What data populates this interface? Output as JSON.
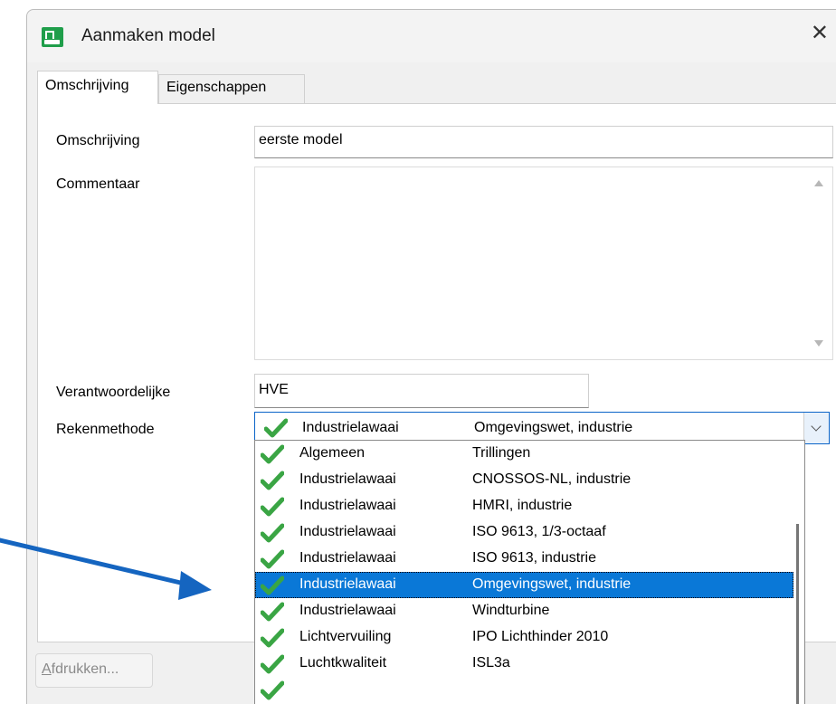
{
  "window": {
    "title": "Aanmaken model",
    "close_glyph": "✕"
  },
  "tabs": [
    {
      "label": "Omschrijving",
      "active": true
    },
    {
      "label": "Eigenschappen",
      "active": false
    }
  ],
  "form": {
    "omschrijving": {
      "label": "Omschrijving",
      "value": "eerste model"
    },
    "commentaar": {
      "label": "Commentaar",
      "value": ""
    },
    "verantwoordelijke": {
      "label": "Verantwoordelijke",
      "value": "HVE"
    },
    "rekenmethode": {
      "label": "Rekenmethode",
      "selected": {
        "category": "Industrielawaai",
        "method": "Omgevingswet, industrie"
      }
    }
  },
  "dropdown": {
    "options": [
      {
        "category": "Algemeen",
        "method": "Trillingen",
        "selected": false
      },
      {
        "category": "Industrielawaai",
        "method": "CNOSSOS-NL, industrie",
        "selected": false
      },
      {
        "category": "Industrielawaai",
        "method": "HMRI, industrie",
        "selected": false
      },
      {
        "category": "Industrielawaai",
        "method": "ISO 9613, 1/3-octaaf",
        "selected": false
      },
      {
        "category": "Industrielawaai",
        "method": "ISO 9613, industrie",
        "selected": false
      },
      {
        "category": "Industrielawaai",
        "method": "Omgevingswet, industrie",
        "selected": true
      },
      {
        "category": "Industrielawaai",
        "method": "Windturbine",
        "selected": false
      },
      {
        "category": "Lichtvervuiling",
        "method": "IPO Lichthinder 2010",
        "selected": false
      },
      {
        "category": "Luchtkwaliteit",
        "method": "ISL3a",
        "selected": false
      }
    ]
  },
  "footer": {
    "print_button_accel": "A",
    "print_button_rest": "fdrukken..."
  },
  "icons": {
    "check": "check-icon",
    "app": "app-logo-icon"
  },
  "colors": {
    "check_green": "#3aa544",
    "selection_blue": "#0a78d7",
    "arrow_blue": "#1565c0",
    "focus_border": "#0a64c8"
  }
}
